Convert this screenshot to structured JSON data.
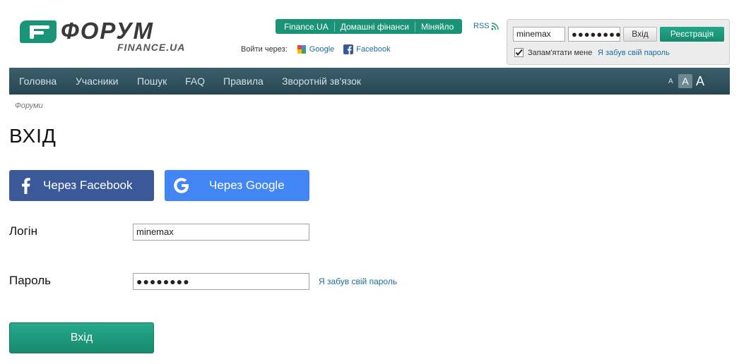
{
  "header": {
    "logo_word": "ФОРУМ",
    "logo_sub": "FINANCE.UA",
    "top_links": [
      "Finance.UA",
      "Домашні фінанси",
      "Міняйло"
    ],
    "rss": "RSS",
    "via_label": "Войти через:",
    "via_google": "Google",
    "via_facebook": "Facebook"
  },
  "loginbox": {
    "login_value": "minemax",
    "password_value": "●●●●●●●●",
    "enter_label": "Вхід",
    "register_label": "Реєстрація",
    "remember_label": "Запам'ятати мене",
    "forgot_label": "Я забув свій пароль"
  },
  "nav": {
    "items": [
      "Головна",
      "Учасники",
      "Пошук",
      "FAQ",
      "Правила",
      "Зворотній зв'язок"
    ],
    "font_small": "A",
    "font_medium": "A",
    "font_large": "A"
  },
  "breadcrumb": "Форуми",
  "page_title": "ВХІД",
  "social": {
    "facebook_label": "Через Facebook",
    "google_label": "Через Google"
  },
  "form": {
    "login_label": "Логін",
    "login_value": "minemax",
    "password_label": "Пароль",
    "password_value": "●●●●●●●●",
    "forgot_label": "Я забув свій пароль",
    "submit_label": "Вхід"
  },
  "colors": {
    "accent_green": "#1a9477",
    "nav_bg": "#2f5360",
    "facebook_blue": "#3b5998",
    "google_blue": "#4285f4",
    "link_blue": "#1a6f9a"
  }
}
